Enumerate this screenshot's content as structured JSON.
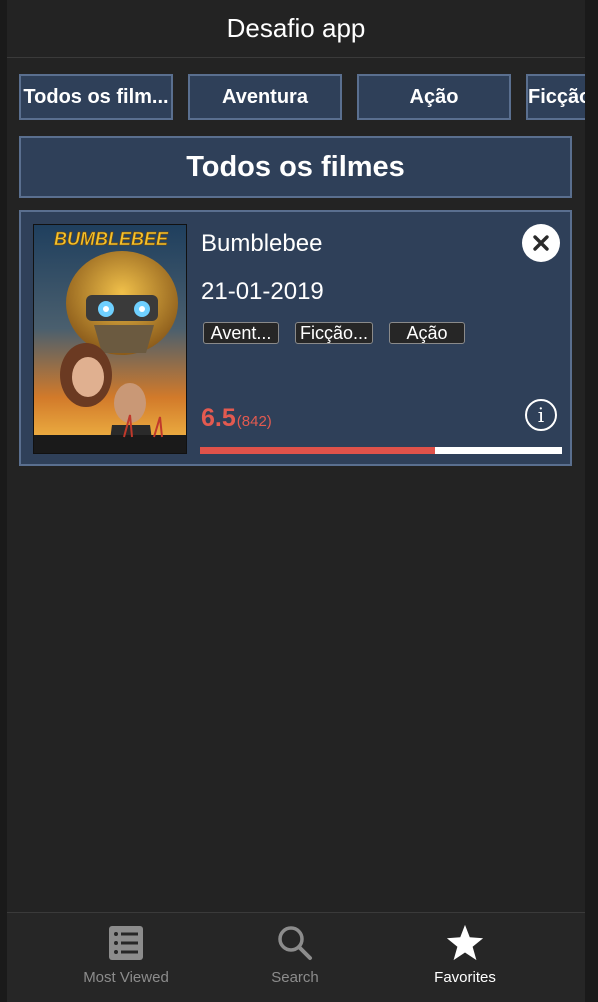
{
  "header": {
    "title": "Desafio app"
  },
  "filters": [
    {
      "label": "Todos os film..."
    },
    {
      "label": "Aventura"
    },
    {
      "label": "Ação"
    },
    {
      "label": "Ficção"
    }
  ],
  "section": {
    "title": "Todos os filmes"
  },
  "movie": {
    "poster_text": "BUMBLEBEE",
    "title": "Bumblebee",
    "date": "21-01-2019",
    "genres": [
      "Avent...",
      "Ficção...",
      "Ação"
    ],
    "rating": "6.5",
    "votes": "(842)",
    "rating_fraction": 0.65
  },
  "tabs": [
    {
      "label": "Most Viewed",
      "icon": "list-icon"
    },
    {
      "label": "Search",
      "icon": "search-icon"
    },
    {
      "label": "Favorites",
      "icon": "star-icon",
      "active": true
    }
  ],
  "colors": {
    "background": "#232323",
    "panel": "#2f4059",
    "panel_border": "#5a6f8f",
    "rating": "#e35a50"
  }
}
